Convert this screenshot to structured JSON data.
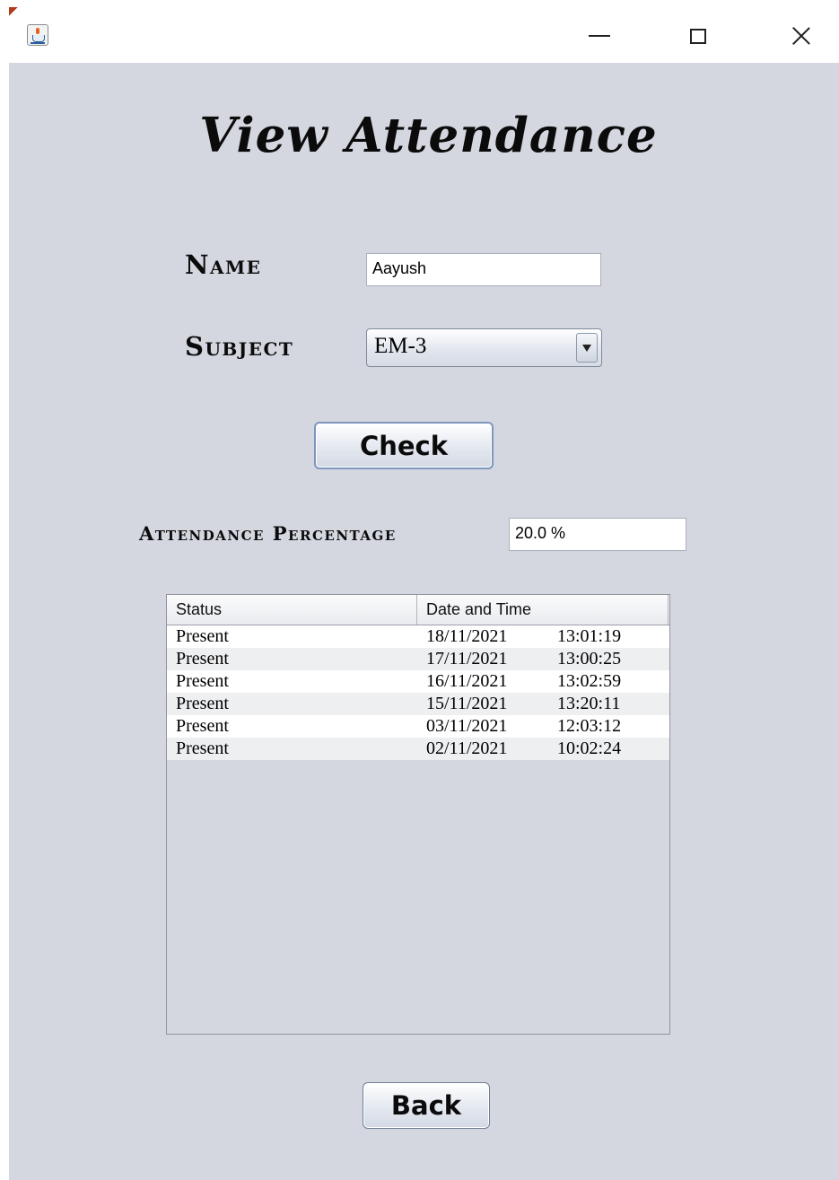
{
  "window": {
    "icon": "java-cup-icon",
    "controls": [
      "minimize",
      "maximize",
      "close"
    ]
  },
  "heading": "View Attendance",
  "form": {
    "name_label": "Name",
    "name_value": "Aayush",
    "subject_label": "Subject",
    "subject_value": "EM-3",
    "check_label": "Check",
    "percentage_label": "Attendance Percentage",
    "percentage_value": "20.0 %"
  },
  "table": {
    "columns": [
      "Status",
      "Date and Time"
    ],
    "rows": [
      {
        "status": "Present",
        "date": "18/11/2021",
        "time": "13:01:19"
      },
      {
        "status": "Present",
        "date": "17/11/2021",
        "time": "13:00:25"
      },
      {
        "status": "Present",
        "date": "16/11/2021",
        "time": "13:02:59"
      },
      {
        "status": "Present",
        "date": "15/11/2021",
        "time": "13:20:11"
      },
      {
        "status": "Present",
        "date": "03/11/2021",
        "time": "12:03:12"
      },
      {
        "status": "Present",
        "date": "02/11/2021",
        "time": "10:02:24"
      }
    ]
  },
  "back_label": "Back",
  "colors": {
    "panel_bg": "#d4d7e0",
    "titlebar_bg": "#ffffff",
    "button_border": "#7d96bd"
  }
}
